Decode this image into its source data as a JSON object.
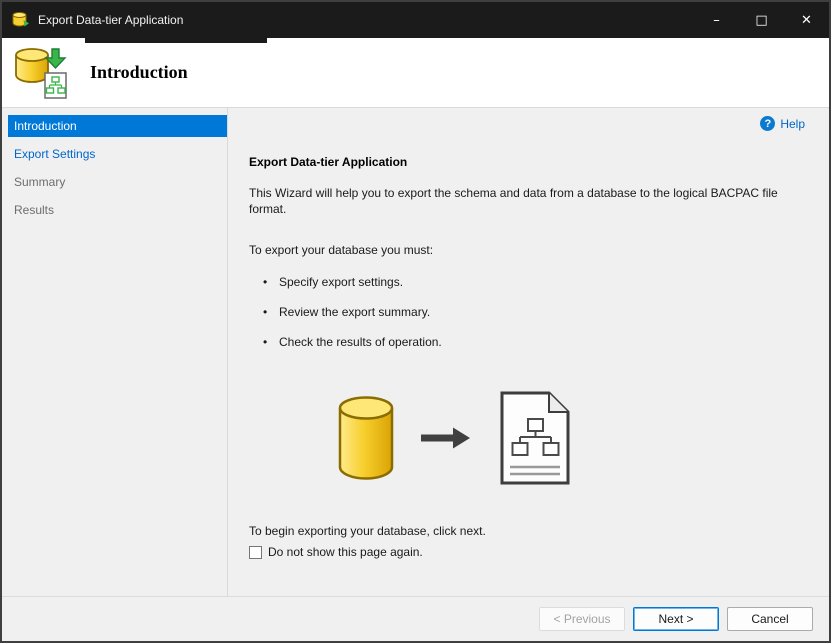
{
  "window": {
    "title": "Export Data-tier Application",
    "controls": {
      "minimize_glyph": "–",
      "maximize_glyph": "□",
      "close_glyph": "✕"
    }
  },
  "header": {
    "title": "Introduction"
  },
  "sidebar": {
    "items": [
      {
        "label": "Introduction",
        "state": "selected"
      },
      {
        "label": "Export Settings",
        "state": "enabled-link"
      },
      {
        "label": "Summary",
        "state": "disabled"
      },
      {
        "label": "Results",
        "state": "disabled"
      }
    ]
  },
  "main": {
    "help": {
      "glyph": "?",
      "label": "Help"
    },
    "heading": "Export Data-tier Application",
    "intro": "This Wizard will help you to export the schema and data from a database to the logical BACPAC file format.",
    "requirements_label": "To export your database you must:",
    "bullets": [
      "Specify export settings.",
      "Review the export summary.",
      "Check the results of operation."
    ],
    "begin_text": "To begin exporting your database, click next.",
    "checkbox_label": "Do not show this page again.",
    "checkbox_checked": false
  },
  "footer": {
    "previous_label": "< Previous",
    "next_label": "Next >",
    "cancel_label": "Cancel"
  },
  "colors": {
    "accent": "#0078d7",
    "link": "#0066cc",
    "titlebar": "#1b1b1b",
    "panel": "#f0f0f0",
    "database_yellow": "#f7cf2e",
    "arrow_green": "#39b54a"
  }
}
